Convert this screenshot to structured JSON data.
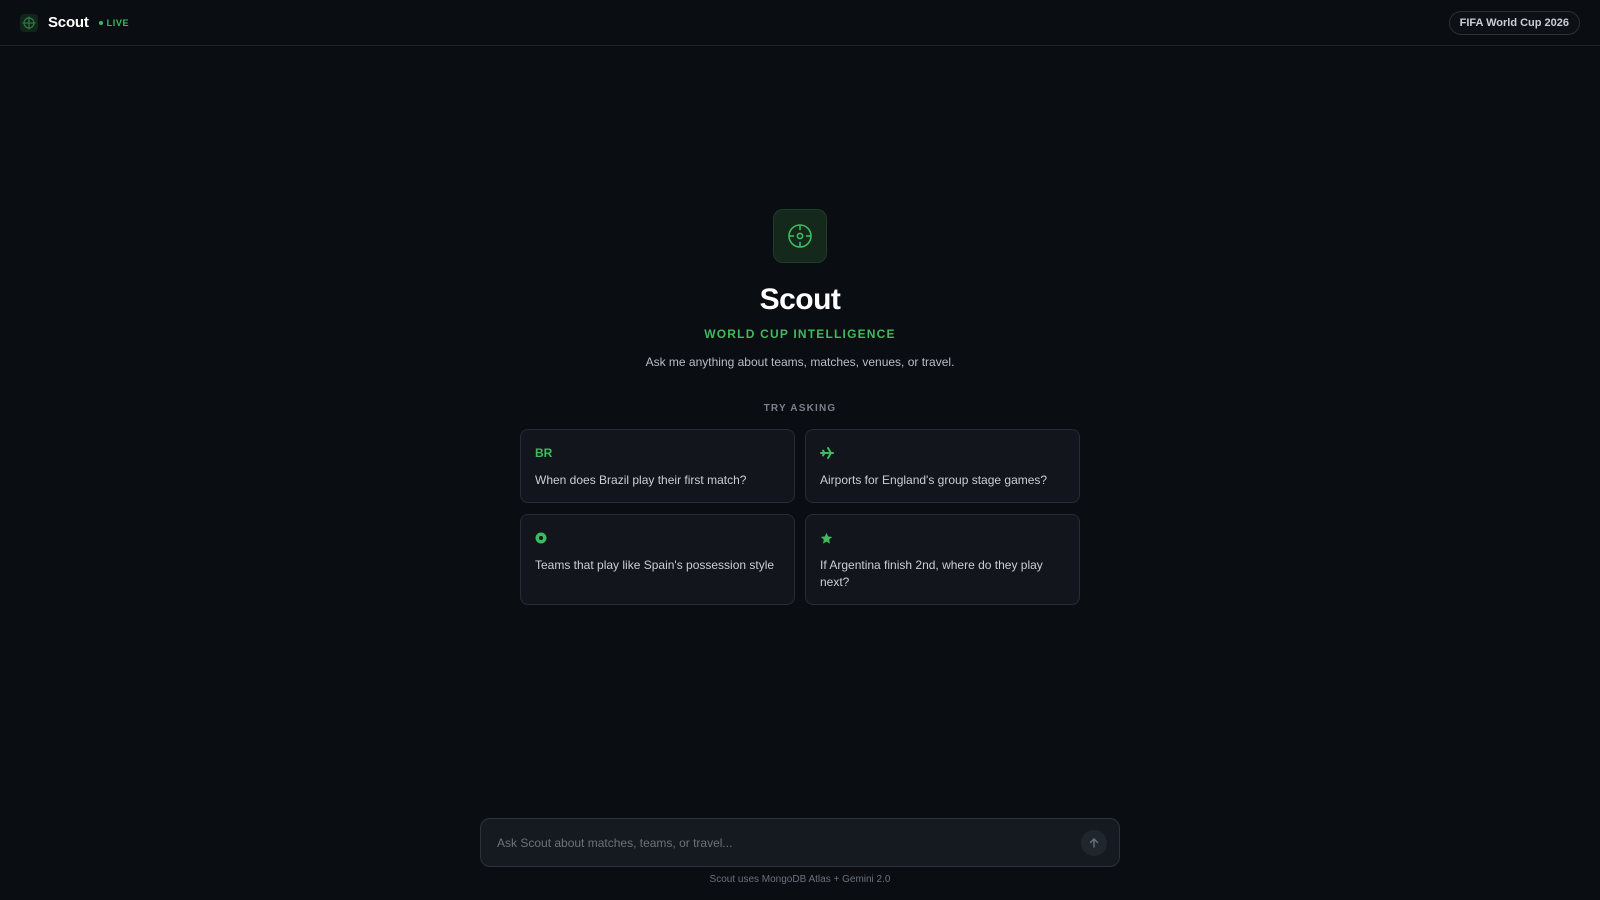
{
  "header": {
    "brand": "Scout",
    "live_label": "LIVE",
    "event_label": "FIFA World Cup 2026"
  },
  "hero": {
    "title": "Scout",
    "subtitle": "WORLD CUP INTELLIGENCE",
    "description": "Ask me anything about teams, matches, venues, or travel.",
    "icon": "crosshair-ball-icon"
  },
  "suggestions": {
    "label": "TRY ASKING",
    "items": [
      {
        "icon": "BR",
        "icon_name": "brazil-code-icon",
        "text": "When does Brazil play their first match?"
      },
      {
        "icon": "plane",
        "icon_name": "airplane-icon",
        "text": "Airports for England's group stage games?"
      },
      {
        "icon": "ball",
        "icon_name": "soccer-ball-icon",
        "text": "Teams that play like Spain's possession style"
      },
      {
        "icon": "star",
        "icon_name": "star-icon",
        "text": "If Argentina finish 2nd, where do they play next?"
      }
    ]
  },
  "composer": {
    "placeholder": "Ask Scout about matches, teams, or travel...",
    "send_icon": "arrow-up-icon"
  },
  "footer": {
    "note": "Scout uses MongoDB Atlas + Gemini 2.0"
  },
  "colors": {
    "background": "#0a0d12",
    "accent": "#3fba5e",
    "card": "#12161c",
    "border": "#262c35"
  }
}
